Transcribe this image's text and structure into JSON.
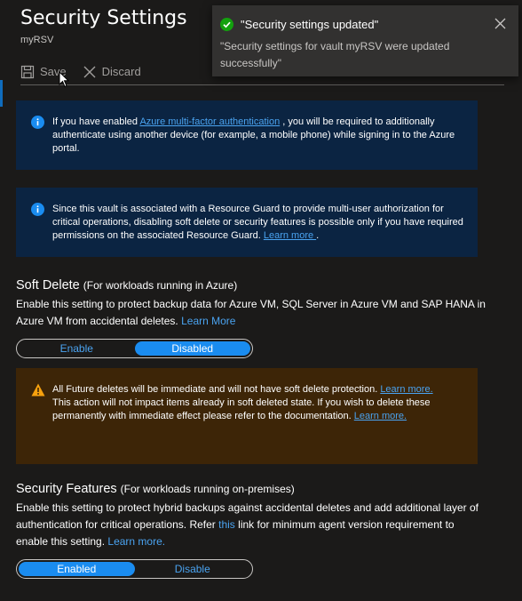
{
  "header": {
    "title": "Security Settings",
    "subtitle": "myRSV"
  },
  "toolbar": {
    "save_label": "Save",
    "discard_label": "Discard"
  },
  "info_boxes": [
    {
      "text_before": "If you have enabled ",
      "link": "Azure multi-factor authentication",
      "text_after": " , you will be required to additionally authenticate using another device (for example, a mobile phone) while signing in to the Azure portal."
    },
    {
      "text_before": "Since this vault is associated with a Resource Guard to provide multi-user authorization for critical operations, disabling soft delete or security features is possible only if you have required permissions on the associated Resource Guard. ",
      "link": "Learn more ",
      "text_after": "."
    }
  ],
  "soft_delete": {
    "title": "Soft Delete",
    "subtitle": "(For workloads running in Azure)",
    "description": "Enable this setting to protect backup data for Azure VM, SQL Server in Azure VM and SAP HANA in Azure VM from accidental deletes. ",
    "learn_more": "Learn More",
    "options": [
      "Enable",
      "Disabled"
    ],
    "selected": "Disabled"
  },
  "warning": {
    "line1": "All Future deletes will be immediate and will not have soft delete protection. ",
    "link1": "Learn more.",
    "line2": "This action will not impact items already in soft deleted state. If you wish to delete these permanently with immediate effect please refer to the documentation. ",
    "link2": "Learn more."
  },
  "security_features": {
    "title": "Security Features",
    "subtitle": "(For workloads running on-premises)",
    "description_before": "Enable this setting to protect hybrid backups against accidental deletes and add additional layer of authentication for critical operations. Refer ",
    "this_link": "this",
    "description_after": " link for minimum agent version requirement to enable this setting. ",
    "learn_more": "Learn more.",
    "options": [
      "Enabled",
      "Disable"
    ],
    "selected": "Enabled"
  },
  "toast": {
    "title": "\"Security settings updated\"",
    "body": "\"Security settings for vault myRSV were updated successfully\""
  },
  "colors": {
    "background": "#1b1a19",
    "info_bg": "#0b2442",
    "warning_bg": "#3d2507",
    "accent": "#1a8cf0",
    "link": "#4aa3f0",
    "success": "#13a10e",
    "warning_icon": "#f7a10e"
  },
  "icons": [
    "save-icon",
    "discard-icon",
    "info-icon",
    "warning-icon",
    "success-check-icon",
    "close-icon",
    "mouse-cursor-icon"
  ]
}
